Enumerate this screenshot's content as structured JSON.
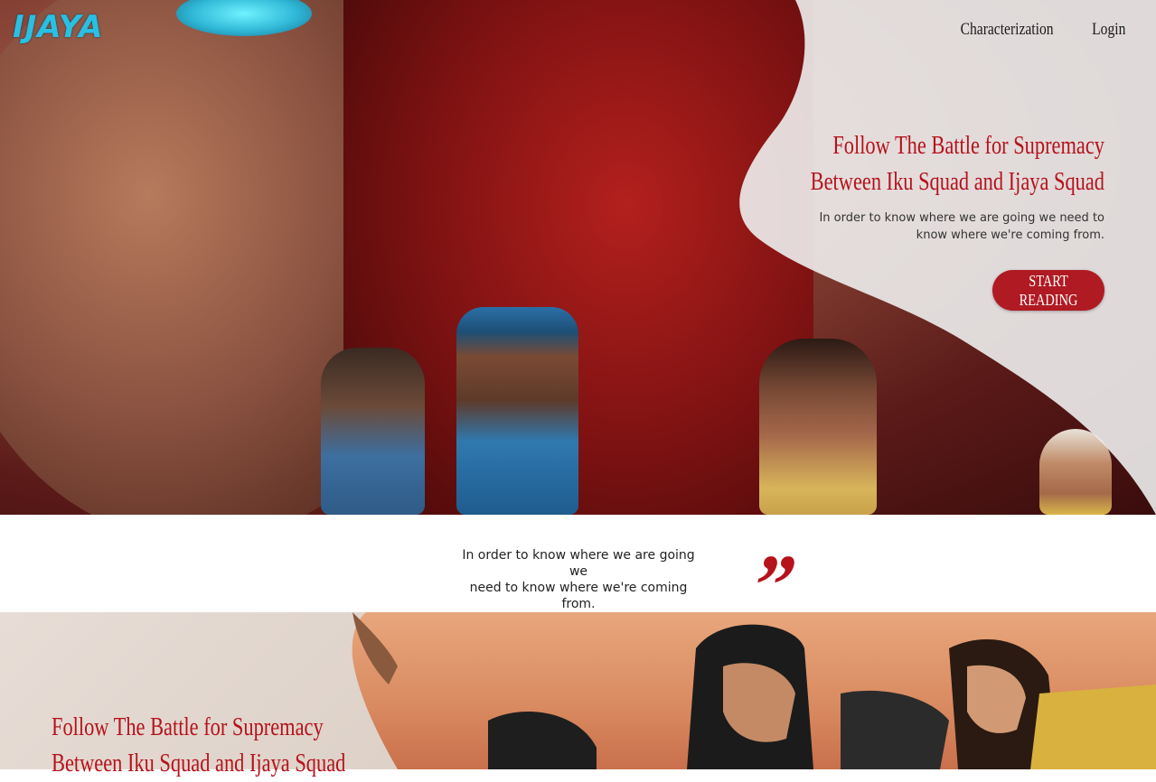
{
  "brand": {
    "logo_text": "IJAYA"
  },
  "nav": {
    "items": [
      "Characterization",
      "Login"
    ]
  },
  "hero": {
    "title_line1": "Follow The Battle for Supremacy",
    "title_line2": "Between Iku Squad and Ijaya Squad",
    "subtitle_line1": "In order to know where we are going we need to",
    "subtitle_line2": "know where we're coming from.",
    "cta_label": "START READING"
  },
  "quote": {
    "line1": "In order to know where we are going we",
    "line2": "need to know where we're coming from.",
    "mark": "”"
  },
  "second_section": {
    "title_line1": "Follow The Battle for Supremacy",
    "title_line2": "Between Iku Squad and Ijaya Squad"
  },
  "colors": {
    "accent": "#b5121b",
    "logo": "#29c0e3"
  }
}
